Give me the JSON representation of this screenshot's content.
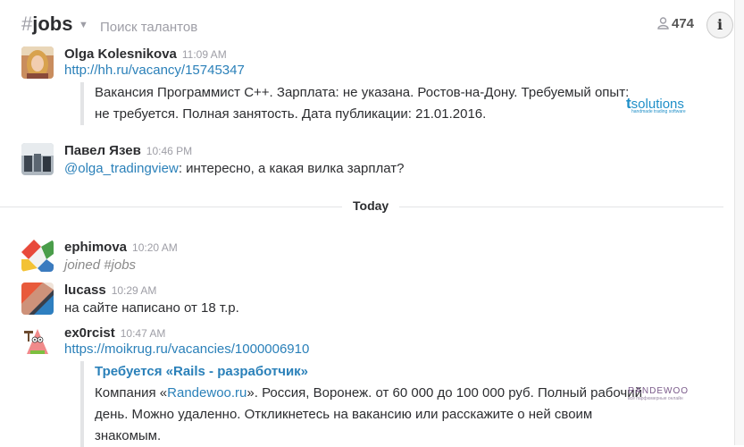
{
  "header": {
    "channel_hash": "#",
    "channel_name": "jobs",
    "topic": "Поиск талантов",
    "member_count": "474"
  },
  "messages": [
    {
      "author": "Olga Kolesnikova",
      "time": "11:09 AM",
      "link": "http://hh.ru/vacancy/15745347",
      "attachment": {
        "line1": "Вакансия Программист С++. Зарплата: не указана. Ростов-на-Дону. Требуемый опыт:",
        "line2": "не требуется. Полная занятость. Дата публикации: 21.01.2016.",
        "logo_brand": "solutions",
        "logo_letter": "t",
        "logo_tagline": "handmade trading software"
      }
    },
    {
      "author": "Павел Язев",
      "time": "10:46 PM",
      "mention": "@olga_tradingview",
      "text": ": интересно, а какая вилка зарплат?"
    },
    {
      "author": "ephimova",
      "time": "10:20 AM",
      "text": "joined #jobs"
    },
    {
      "author": "lucass",
      "time": "10:29 AM",
      "text": "на сайте написано от 18 т.р."
    },
    {
      "author": "ex0rcist",
      "time": "10:47 AM",
      "link": "https://moikrug.ru/vacancies/1000006910",
      "attachment": {
        "title": "Требуется «Rails - разработчик»",
        "line1_prefix": "Компания «",
        "line1_link": "Randewoo.ru",
        "line1_suffix": "». Россия, Воронеж. от 60 000 до 100 000 руб. Полный рабочий",
        "line2": "день. Можно удаленно. Откликнетесь на вакансию или расскажите о ней своим",
        "line3": "знакомым.",
        "logo_brand": "RANDEWOO",
        "logo_tagline": "все парфюмерные онлайн"
      }
    }
  ],
  "divider": {
    "label": "Today"
  },
  "colors": {
    "link": "#2a80b9",
    "muted": "#9e9ea6",
    "logo_blue": "#1f8fc8"
  },
  "icons": {
    "members": "person-icon",
    "info": "info-icon",
    "chevron": "chevron-down-icon"
  }
}
